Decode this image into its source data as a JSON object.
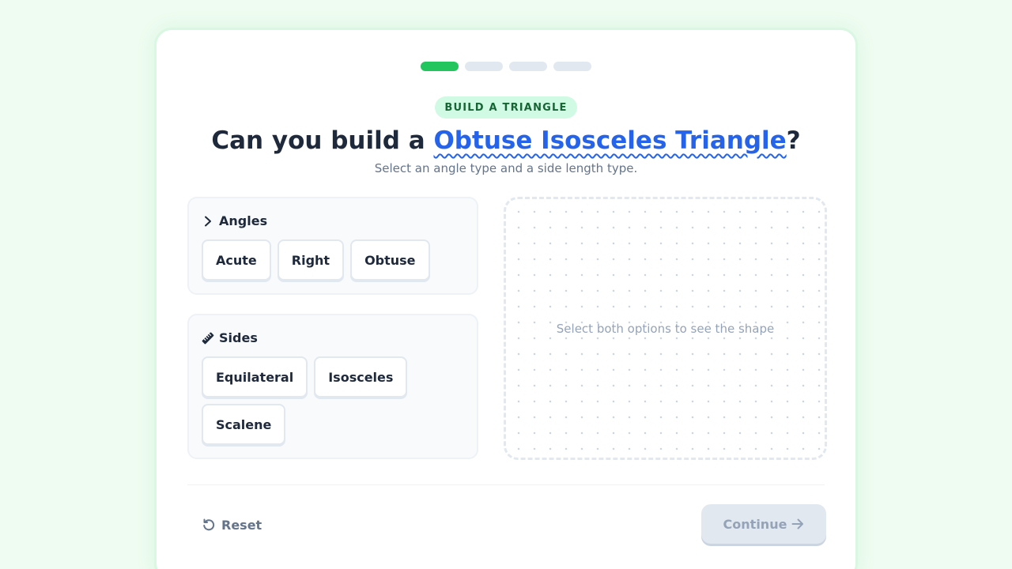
{
  "progress": {
    "total_steps": 4,
    "current_step": 1,
    "colors": {
      "active": "#22c55e",
      "inactive": "#e2e8f0"
    }
  },
  "badge": "BUILD A TRIANGLE",
  "question": {
    "prefix": "Can you build a ",
    "target": "Obtuse Isosceles Triangle",
    "suffix": "?"
  },
  "subtitle": "Select an angle type and a side length type.",
  "angles": {
    "label": "Angles",
    "icon": "chevron-right-icon",
    "options": [
      "Acute",
      "Right",
      "Obtuse"
    ]
  },
  "sides": {
    "label": "Sides",
    "icon": "ruler-icon",
    "options": [
      "Equilateral",
      "Isosceles",
      "Scalene"
    ]
  },
  "preview": {
    "placeholder": "Select both options to see the shape"
  },
  "footer": {
    "reset_label": "Reset",
    "reset_icon": "undo-icon",
    "continue_label": "Continue",
    "continue_icon": "arrow-right-icon",
    "continue_disabled": true
  },
  "colors": {
    "accent": "#22c55e",
    "link": "#2563eb",
    "background": "#effcf1"
  }
}
